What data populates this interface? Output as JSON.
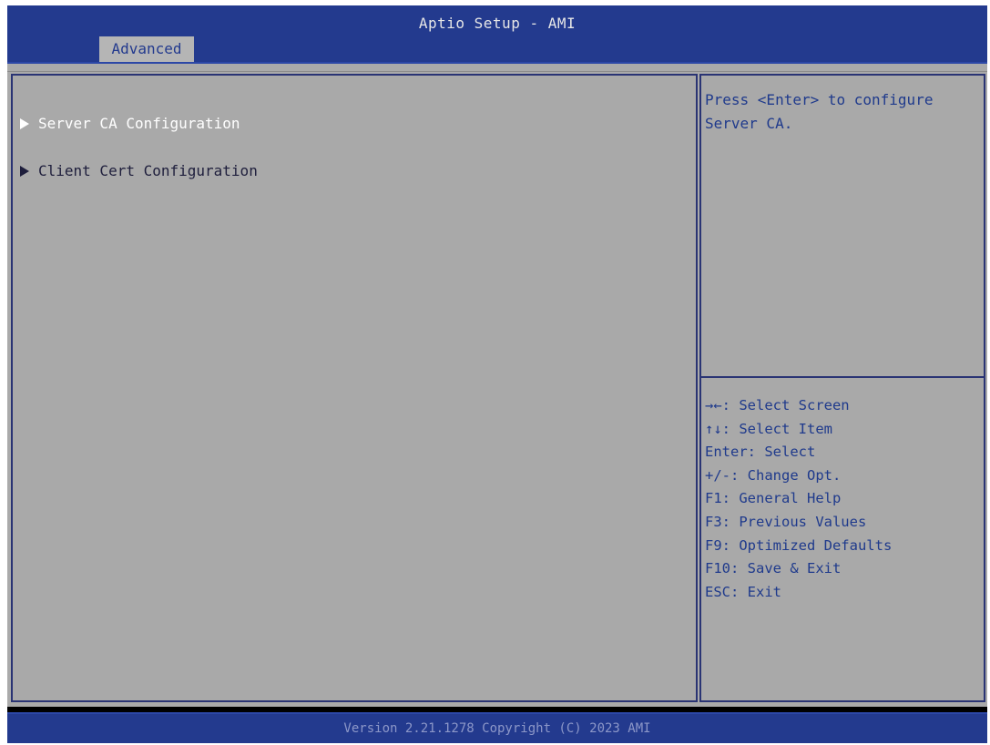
{
  "header": {
    "title": "Aptio Setup - AMI",
    "active_tab": "Advanced"
  },
  "menu": {
    "items": [
      {
        "label": "Server CA Configuration",
        "selected": true
      },
      {
        "label": "Client Cert Configuration",
        "selected": false
      }
    ]
  },
  "help": {
    "description": "Press <Enter> to configure Server CA.",
    "keys": [
      "→←: Select Screen",
      "↑↓: Select Item",
      "Enter: Select",
      "+/-: Change Opt.",
      "F1: General Help",
      "F3: Previous Values",
      "F9: Optimized Defaults",
      "F10: Save & Exit",
      "ESC: Exit"
    ]
  },
  "footer": {
    "version": "Version 2.21.1278 Copyright (C) 2023 AMI"
  },
  "colors": {
    "title_bar": "#233a8e",
    "panel_background": "#aaaaaa",
    "help_text": "#1f3a8c",
    "selected_item": "#ffffff"
  }
}
